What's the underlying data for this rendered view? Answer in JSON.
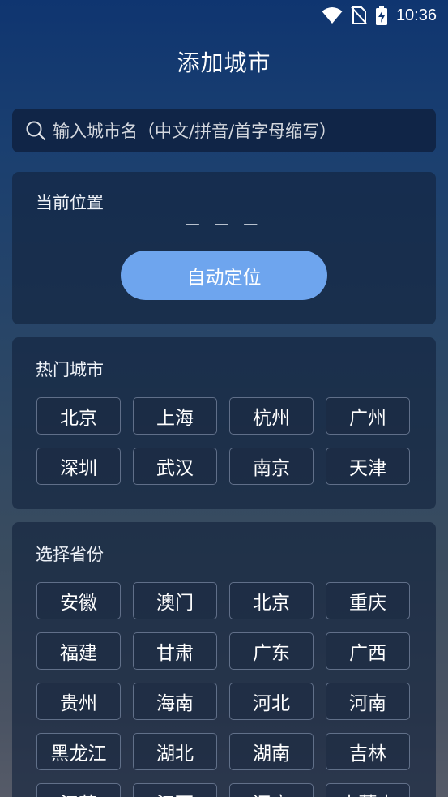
{
  "status_bar": {
    "time": "10:36",
    "icons": [
      "wifi-icon",
      "no-sim-icon",
      "battery-charging-icon"
    ]
  },
  "page": {
    "title": "添加城市"
  },
  "search": {
    "placeholder": "输入城市名（中文/拼音/首字母缩写）",
    "icon": "search-icon"
  },
  "location": {
    "title": "当前位置",
    "value": "— — —",
    "button_label": "自动定位",
    "button_color": "#6ea5ee"
  },
  "hot_cities": {
    "title": "热门城市",
    "items": [
      "北京",
      "上海",
      "杭州",
      "广州",
      "深圳",
      "武汉",
      "南京",
      "天津"
    ]
  },
  "provinces": {
    "title": "选择省份",
    "items": [
      "安徽",
      "澳门",
      "北京",
      "重庆",
      "福建",
      "甘肃",
      "广东",
      "广西",
      "贵州",
      "海南",
      "河北",
      "河南",
      "黑龙江",
      "湖北",
      "湖南",
      "吉林",
      "江苏",
      "江西",
      "辽宁",
      "内蒙古"
    ]
  }
}
